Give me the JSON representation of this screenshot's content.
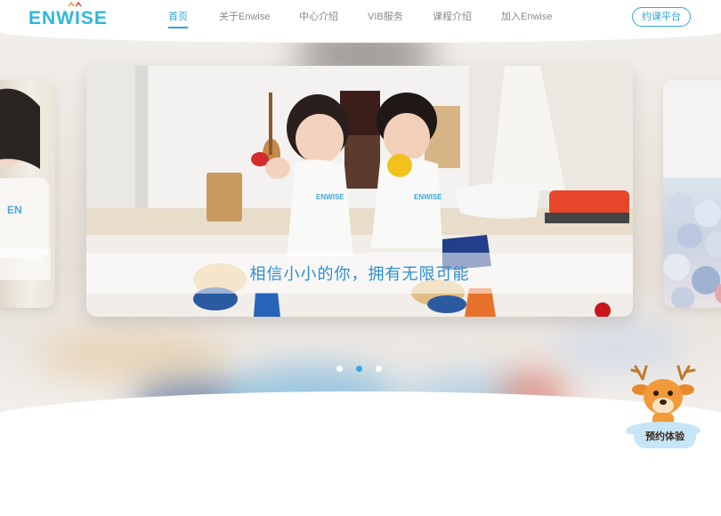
{
  "brand": {
    "logo_text": "ENWISE"
  },
  "nav": {
    "items": [
      {
        "label": "首页",
        "active": true
      },
      {
        "label": "关于Enwise"
      },
      {
        "label": "中心介绍"
      },
      {
        "label": "VIB服务"
      },
      {
        "label": "课程介绍"
      },
      {
        "label": "加入Enwise"
      }
    ],
    "platform_button": "约课平台"
  },
  "hero": {
    "caption": "相信小小的你，拥有无限可能",
    "dots_count": 3,
    "active_dot": 1
  },
  "floating": {
    "book_trial": "预约体验"
  },
  "colors": {
    "accent": "#2fa4dc",
    "logo": "#2eb7dd",
    "caption": "#2d8fd2"
  }
}
